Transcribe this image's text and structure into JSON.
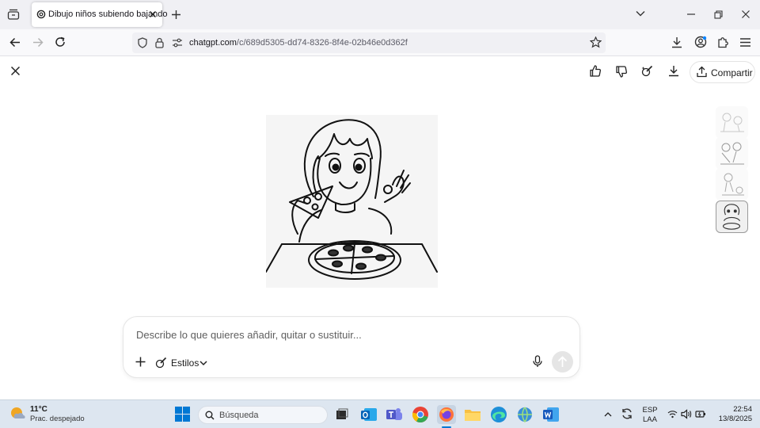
{
  "browser": {
    "tab": {
      "title": "Dibujo niños subiendo bajando"
    },
    "url": {
      "host": "chatgpt.com",
      "path": "/c/689d5305-dd74-8326-8f4e-02b46e0d362f"
    }
  },
  "page": {
    "share_label": "Compartir",
    "image_thumbnails_count": 4,
    "composer": {
      "placeholder": "Describe lo que quieres añadir, quitar o sustituir...",
      "styles_label": "Estilos"
    }
  },
  "taskbar": {
    "weather": {
      "temp": "11°C",
      "desc": "Prac. despejado"
    },
    "search_label": "Búsqueda",
    "language": {
      "lang": "ESP",
      "layout": "LAA"
    },
    "clock": {
      "time": "22:54",
      "date": "13/8/2025"
    }
  },
  "colors": {
    "accent_windows": "#0078d4",
    "firefox_orange": "#ff7139",
    "chrome_red": "#ea4335"
  }
}
